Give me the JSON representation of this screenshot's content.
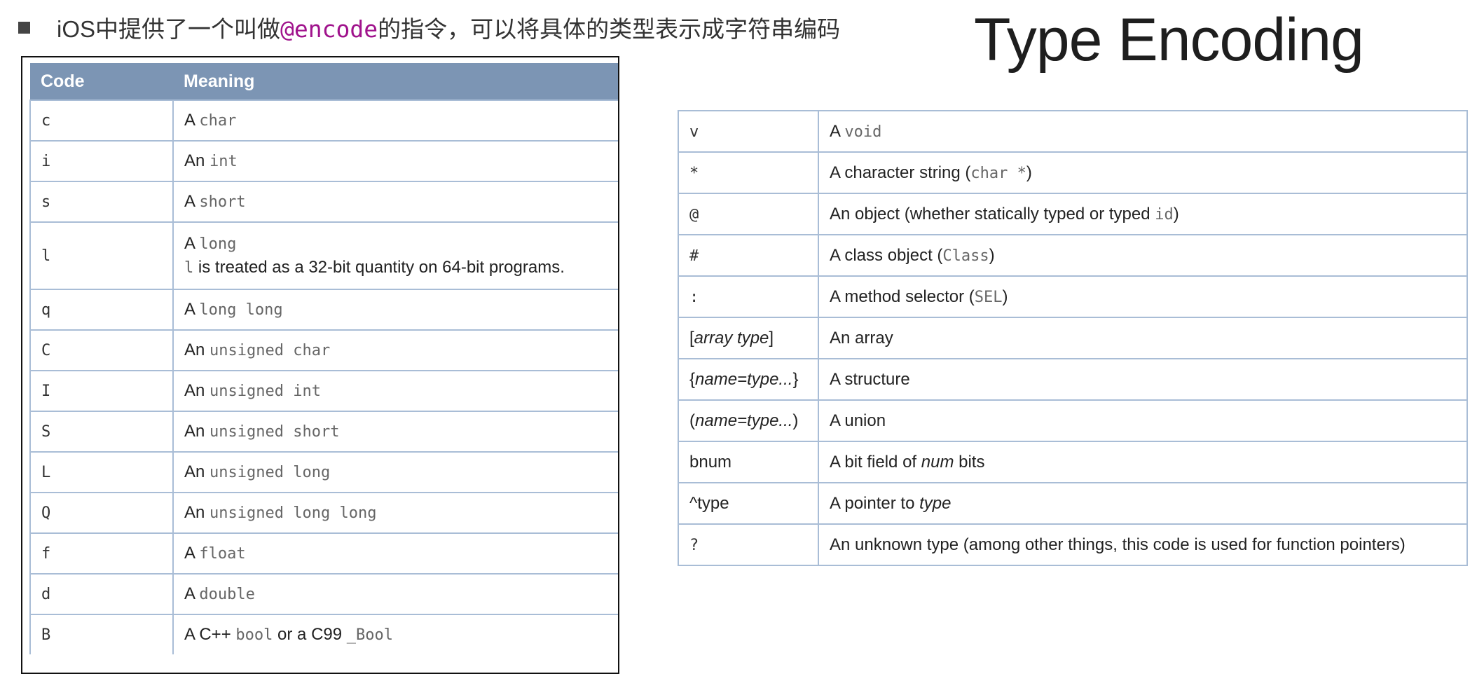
{
  "header": {
    "bullet_text_before": "iOS中提供了一个叫做",
    "bullet_keyword": "@encode",
    "bullet_text_after": "的指令，可以将具体的类型表示成字符串编码",
    "title": "Type Encoding"
  },
  "left_table": {
    "headers": [
      "Code",
      "Meaning"
    ],
    "rows": [
      {
        "code": "c",
        "pre": "A ",
        "type": "char",
        "post": ""
      },
      {
        "code": "i",
        "pre": "An ",
        "type": "int",
        "post": ""
      },
      {
        "code": "s",
        "pre": "A ",
        "type": "short",
        "post": ""
      },
      {
        "code": "l",
        "pre": "A ",
        "type": "long",
        "post": "",
        "note_code": "l",
        "note_text": " is treated as a 32-bit quantity on 64-bit programs."
      },
      {
        "code": "q",
        "pre": "A ",
        "type": "long long",
        "post": ""
      },
      {
        "code": "C",
        "pre": "An ",
        "type": "unsigned char",
        "post": ""
      },
      {
        "code": "I",
        "pre": "An ",
        "type": "unsigned int",
        "post": ""
      },
      {
        "code": "S",
        "pre": "An ",
        "type": "unsigned short",
        "post": ""
      },
      {
        "code": "L",
        "pre": "An ",
        "type": "unsigned long",
        "post": ""
      },
      {
        "code": "Q",
        "pre": "An ",
        "type": "unsigned long long",
        "post": ""
      },
      {
        "code": "f",
        "pre": "A ",
        "type": "float",
        "post": ""
      },
      {
        "code": "d",
        "pre": "A ",
        "type": "double",
        "post": ""
      },
      {
        "code": "B",
        "pre": "A C++ ",
        "type": "bool",
        "post": " or a C99 ",
        "type2": "_Bool"
      }
    ]
  },
  "right_table": {
    "rows": [
      {
        "code": "v",
        "pre": "A ",
        "type": "void",
        "post": ""
      },
      {
        "code": "*",
        "pre": "A character string (",
        "type": "char *",
        "post": ")"
      },
      {
        "code": "@",
        "pre": "An object (whether statically typed or typed ",
        "type": "id",
        "post": ")"
      },
      {
        "code": "#",
        "pre": "A class object (",
        "type": "Class",
        "post": ")"
      },
      {
        "code": ":",
        "pre": "A method selector (",
        "type": "SEL",
        "post": ")"
      },
      {
        "code_pre": "[",
        "code_it": "array type",
        "code_post": "]",
        "pre": "An array"
      },
      {
        "code_pre": "{",
        "code_it": "name=type...",
        "code_post": "}",
        "pre": "A structure"
      },
      {
        "code_pre": "(",
        "code_it": "name=type...",
        "code_post": ")",
        "pre": "A union"
      },
      {
        "code_pre": "b",
        "code_it": "",
        "code_post": "num",
        "pre": "A bit field of ",
        "it": "num",
        "post": " bits"
      },
      {
        "code_pre": "^type",
        "code_it": "",
        "code_post": "",
        "pre": "A pointer to ",
        "it": "type",
        "post": ""
      },
      {
        "code": "?",
        "pre": "An unknown type (among other things, this code is used for function pointers)"
      }
    ]
  }
}
